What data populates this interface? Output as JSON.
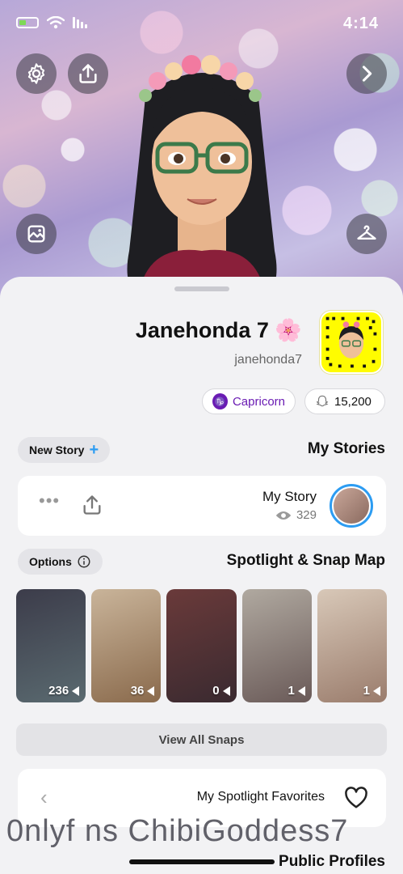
{
  "status_bar": {
    "time": "4:14"
  },
  "profile": {
    "display_name": "Janehonda 7 🌸",
    "username": "janehonda7",
    "snap_score": "15,200",
    "zodiac": "Capricorn",
    "zodiac_symbol": "♑"
  },
  "my_stories": {
    "title": "My Stories",
    "new_story_label": "New Story",
    "story_title": "My Story",
    "story_views": "329"
  },
  "spotlight": {
    "title": "Spotlight & Snap Map",
    "options_label": "Options",
    "thumbnails": [
      {
        "count": "236",
        "colors": [
          "#3c3c4a",
          "#5a6a70"
        ]
      },
      {
        "count": "36",
        "colors": [
          "#c9b49a",
          "#8a6a4c"
        ]
      },
      {
        "count": "0",
        "colors": [
          "#6a3a3a",
          "#3a2a30"
        ]
      },
      {
        "count": "1",
        "colors": [
          "#b0a9a0",
          "#6a5a58"
        ]
      },
      {
        "count": "1",
        "colors": [
          "#d8c8b8",
          "#9a7c6c"
        ]
      }
    ],
    "view_all_label": "View All Snaps"
  },
  "favorites": {
    "label": "My Spotlight Favorites"
  },
  "public_profiles": {
    "title": "Public Profiles"
  },
  "watermark": "0nlyf ns ChibiGoddess7",
  "colors": {
    "accent_blue": "#2c9cf2",
    "snap_yellow": "#fffc00",
    "zodiac_purple": "#6a1bb3"
  }
}
